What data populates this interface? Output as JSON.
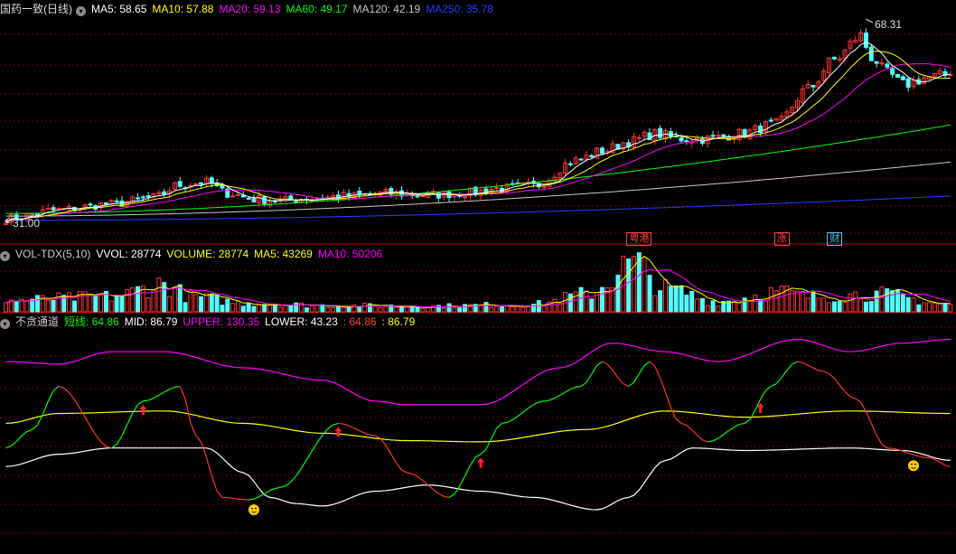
{
  "price_panel": {
    "title": "国药一致(日线)",
    "ma_items": [
      {
        "label": "MA5: 58.65",
        "color": "#ffffff"
      },
      {
        "label": "MA10: 57.88",
        "color": "#ffff00"
      },
      {
        "label": "MA20: 59.13",
        "color": "#ff00ff"
      },
      {
        "label": "MA60: 49.17",
        "color": "#00ff00"
      },
      {
        "label": "MA120: 42.19",
        "color": "#c8c8c8"
      },
      {
        "label": "MA250: 35.78",
        "color": "#2a3cff"
      }
    ],
    "high_label": "68.31",
    "low_label": "31.00",
    "tags": [
      {
        "text": "粤港",
        "color": "#ff4444",
        "border": "#ff4444"
      },
      {
        "text": "涨",
        "color": "#ff4444",
        "border": "#ff4444"
      },
      {
        "text": "财",
        "color": "#4fc3ff",
        "border": "#4fc3ff"
      }
    ]
  },
  "volume_panel": {
    "items": [
      {
        "label": "VOL-TDX(5,10)",
        "color": "#cccccc"
      },
      {
        "label": "VVOL: 28774",
        "color": "#ffffff"
      },
      {
        "label": "VOLUME: 28774",
        "color": "#ffff00"
      },
      {
        "label": "MA5: 43269",
        "color": "#ffff00"
      },
      {
        "label": "MA10: 50206",
        "color": "#ff00ff"
      }
    ]
  },
  "indicator_panel": {
    "items": [
      {
        "label": "不贪通道",
        "color": "#cccccc"
      },
      {
        "label": "短线: 64.86",
        "color": "#00ff00"
      },
      {
        "label": "MID: 86.79",
        "color": "#ffffff"
      },
      {
        "label": "UPPER: 130.35",
        "color": "#ff00ff"
      },
      {
        "label": "LOWER: 43.23",
        "color": "#ffffff"
      },
      {
        "label": ": 64.86",
        "color": "#ff4444"
      },
      {
        "label": ": 86.79",
        "color": "#ffff00"
      }
    ]
  },
  "colors": {
    "up": "#ff3232",
    "down": "#54fcfc",
    "grid": "#7a0000",
    "ma5": "#ffffff",
    "ma10": "#ffff00",
    "ma20": "#ff00ff",
    "ma60": "#00ff00",
    "ma120": "#c8c8c8",
    "ma250": "#2a3cff",
    "short_up": "#00ff00",
    "short_down": "#ff3232",
    "mid": "#ffff00",
    "upper": "#ff00ff",
    "lower": "#ffffff",
    "buy_arrow": "#ff2020",
    "face": "#ffcc00"
  },
  "chart_data": [
    {
      "type": "candlestick",
      "title": "国药一致(日线)",
      "bars": 180,
      "ylim": [
        31.0,
        68.31
      ],
      "anchors_close": [
        [
          0,
          31.5
        ],
        [
          10,
          33.2
        ],
        [
          20,
          34.3
        ],
        [
          28,
          35.5
        ],
        [
          33,
          37.9
        ],
        [
          38,
          38.4
        ],
        [
          42,
          36.3
        ],
        [
          47,
          35.2
        ],
        [
          52,
          34.9
        ],
        [
          58,
          35.4
        ],
        [
          65,
          35.8
        ],
        [
          72,
          36.3
        ],
        [
          80,
          36.0
        ],
        [
          88,
          36.4
        ],
        [
          93,
          37.2
        ],
        [
          100,
          37.7
        ],
        [
          108,
          42.5
        ],
        [
          113,
          44.3
        ],
        [
          118,
          46.0
        ],
        [
          123,
          47.5
        ],
        [
          128,
          46.6
        ],
        [
          133,
          46.6
        ],
        [
          139,
          47.5
        ],
        [
          146,
          49.4
        ],
        [
          152,
          56.0
        ],
        [
          157,
          61.5
        ],
        [
          162,
          66.0
        ],
        [
          164,
          62.0
        ],
        [
          167,
          59.0
        ],
        [
          170,
          56.8
        ],
        [
          175,
          58.2
        ],
        [
          179,
          58.65
        ]
      ],
      "ma_series": [
        "MA5",
        "MA10",
        "MA20",
        "MA60",
        "MA120",
        "MA250"
      ],
      "ma_end_values": {
        "MA5": 58.65,
        "MA10": 57.88,
        "MA20": 59.13,
        "MA60": 49.17,
        "MA120": 42.19,
        "MA250": 35.78
      },
      "ma250_range": [
        31.2,
        35.78
      ],
      "ma120_range": [
        32.0,
        42.19
      ],
      "ma60_range": [
        32.5,
        49.17
      ],
      "high": 68.31,
      "low": 31.0,
      "event_tags": [
        {
          "bar": 119,
          "text": "粤港"
        },
        {
          "bar": 147,
          "text": "涨"
        },
        {
          "bar": 157,
          "text": "财"
        }
      ]
    },
    {
      "type": "bar",
      "title": "VOL-TDX(5,10)",
      "last_volume": 28774,
      "ma5": 43269,
      "ma10": 50206,
      "anchors_volume": [
        [
          0,
          45000
        ],
        [
          20,
          60000
        ],
        [
          30,
          110000
        ],
        [
          35,
          60000
        ],
        [
          45,
          35000
        ],
        [
          60,
          25000
        ],
        [
          80,
          22000
        ],
        [
          100,
          30000
        ],
        [
          110,
          70000
        ],
        [
          119,
          190000
        ],
        [
          125,
          90000
        ],
        [
          135,
          40000
        ],
        [
          147,
          80000
        ],
        [
          152,
          60000
        ],
        [
          165,
          70000
        ],
        [
          179,
          28774
        ]
      ]
    },
    {
      "type": "line",
      "title": "不贪通道",
      "series": [
        {
          "name": "短线",
          "last": 64.86,
          "anchors": [
            [
              0,
              80
            ],
            [
              5,
              95
            ],
            [
              10,
              130
            ],
            [
              20,
              80
            ],
            [
              26,
              118
            ],
            [
              33,
              130
            ],
            [
              36,
              90
            ],
            [
              41,
              40
            ],
            [
              46,
              38
            ],
            [
              52,
              48
            ],
            [
              63,
              100
            ],
            [
              70,
              90
            ],
            [
              76,
              60
            ],
            [
              84,
              40
            ],
            [
              90,
              75
            ],
            [
              94,
              100
            ],
            [
              102,
              118
            ],
            [
              109,
              130
            ],
            [
              113,
              150
            ],
            [
              118,
              130
            ],
            [
              122,
              150
            ],
            [
              128,
              100
            ],
            [
              133,
              85
            ],
            [
              140,
              100
            ],
            [
              145,
              130
            ],
            [
              150,
              150
            ],
            [
              155,
              142
            ],
            [
              161,
              120
            ],
            [
              167,
              80
            ],
            [
              175,
              72
            ],
            [
              179,
              64.86
            ]
          ]
        },
        {
          "name": "MID",
          "last": 86.79,
          "anchors": [
            [
              0,
              100
            ],
            [
              10,
              108
            ],
            [
              30,
              110
            ],
            [
              45,
              100
            ],
            [
              60,
              92
            ],
            [
              76,
              86
            ],
            [
              90,
              85
            ],
            [
              110,
              95
            ],
            [
              125,
              110
            ],
            [
              140,
              105
            ],
            [
              160,
              110
            ],
            [
              179,
              108
            ]
          ]
        },
        {
          "name": "UPPER",
          "last": 130.35,
          "anchors": [
            [
              0,
              150
            ],
            [
              10,
              148
            ],
            [
              20,
              158
            ],
            [
              30,
              158
            ],
            [
              45,
              145
            ],
            [
              60,
              135
            ],
            [
              70,
              118
            ],
            [
              76,
              115
            ],
            [
              90,
              115
            ],
            [
              105,
              145
            ],
            [
              115,
              165
            ],
            [
              125,
              158
            ],
            [
              135,
              150
            ],
            [
              150,
              168
            ],
            [
              160,
              158
            ],
            [
              170,
              165
            ],
            [
              179,
              168
            ]
          ]
        },
        {
          "name": "LOWER",
          "last": 43.23,
          "anchors": [
            [
              0,
              65
            ],
            [
              10,
              75
            ],
            [
              20,
              80
            ],
            [
              38,
              80
            ],
            [
              45,
              60
            ],
            [
              50,
              40
            ],
            [
              55,
              35
            ],
            [
              60,
              33
            ],
            [
              70,
              45
            ],
            [
              80,
              50
            ],
            [
              90,
              45
            ],
            [
              100,
              40
            ],
            [
              112,
              30
            ],
            [
              118,
              40
            ],
            [
              125,
              70
            ],
            [
              130,
              80
            ],
            [
              140,
              78
            ],
            [
              160,
              80
            ],
            [
              170,
              78
            ],
            [
              179,
              70
            ]
          ]
        }
      ],
      "buy_arrows_bars": [
        26,
        63,
        90,
        143
      ],
      "face_markers_bars": [
        47,
        172
      ],
      "ylim": [
        0,
        175
      ]
    }
  ]
}
